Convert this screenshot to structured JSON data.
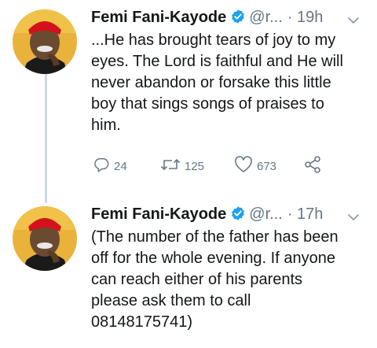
{
  "tweets": [
    {
      "name": "Femi Fani-Kayode",
      "handle": "@r...",
      "time": "· 19h",
      "lines": [
        "...He has brought tears of joy to my",
        "eyes. The Lord is faithful and He will",
        "never abandon or forsake this little",
        "boy that sings songs of praises to",
        "him."
      ],
      "replies": "24",
      "retweets": "125",
      "likes": "673"
    },
    {
      "name": "Femi Fani-Kayode",
      "handle": "@r...",
      "time": "· 17h",
      "lines": [
        "(The number of the father has been",
        "off for the whole evening. If anyone",
        "can reach either of his parents",
        "please ask them to call",
        "08148175741)"
      ]
    }
  ],
  "colors": {
    "verified": "#1da1f2",
    "muted": "#657786",
    "text": "#14171a",
    "thread_line": "#cfd9de"
  },
  "icons": [
    "verified-badge-icon",
    "chevron-down-icon",
    "reply-icon",
    "retweet-icon",
    "like-icon",
    "share-icon"
  ]
}
